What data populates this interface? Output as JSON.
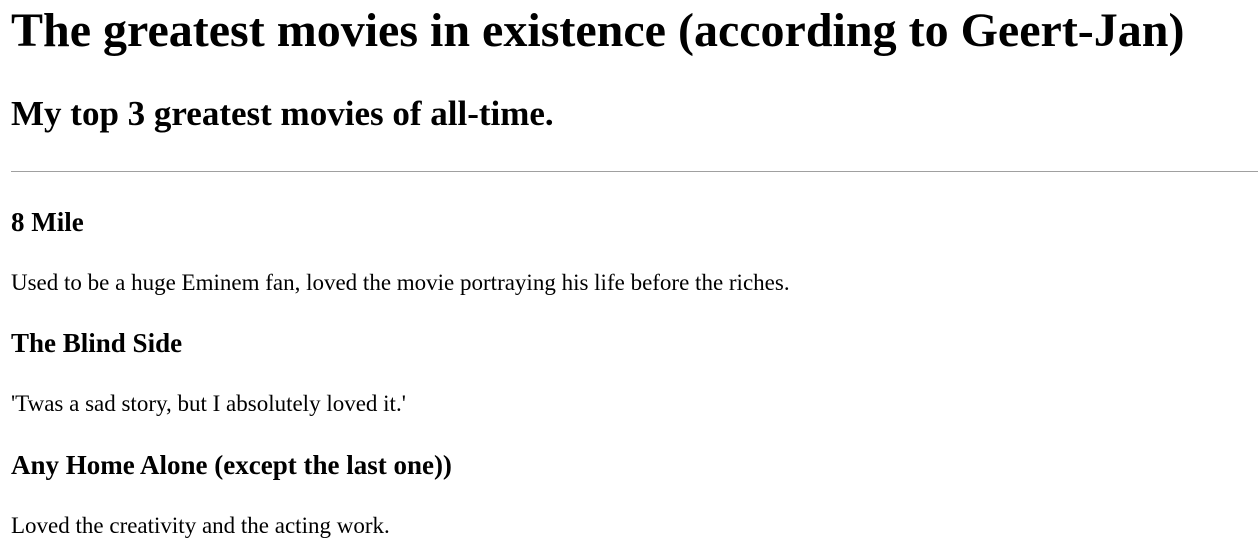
{
  "page": {
    "title": "The greatest movies in existence (according to Geert-Jan)",
    "subtitle": "My top 3 greatest movies of all-time."
  },
  "movies": [
    {
      "title": "8 Mile",
      "description": "Used to be a huge Eminem fan, loved the movie portraying his life before the riches."
    },
    {
      "title": "The Blind Side",
      "description": "'Twas a sad story, but I absolutely loved it.'"
    },
    {
      "title": "Any Home Alone (except the last one))",
      "description": "Loved the creativity and the acting work."
    }
  ]
}
